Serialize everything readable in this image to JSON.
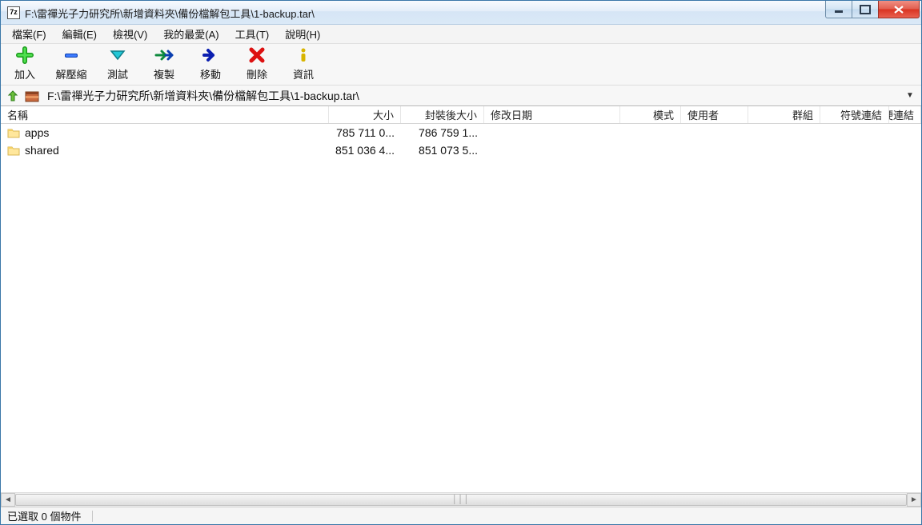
{
  "window": {
    "title": "F:\\雷禪光子力研究所\\新增資料夾\\備份檔解包工具\\1-backup.tar\\"
  },
  "menu": {
    "file": "檔案(F)",
    "edit": "編輯(E)",
    "view": "檢視(V)",
    "fav": "我的最愛(A)",
    "tools": "工具(T)",
    "help": "說明(H)"
  },
  "toolbar": {
    "add": "加入",
    "extract": "解壓縮",
    "test": "測試",
    "copy": "複製",
    "move": "移動",
    "delete": "刪除",
    "info": "資訊"
  },
  "address": {
    "path": "F:\\雷禪光子力研究所\\新增資料夾\\備份檔解包工具\\1-backup.tar\\"
  },
  "columns": {
    "name": "名稱",
    "size": "大小",
    "packed": "封裝後大小",
    "mtime": "修改日期",
    "mode": "模式",
    "user": "使用者",
    "group": "群組",
    "sym": "符號連結",
    "hard": "硬連結"
  },
  "rows": [
    {
      "name": "apps",
      "size": "785 711 0...",
      "packed": "786 759 1...",
      "mtime": "",
      "mode": "",
      "user": "",
      "group": "",
      "sym": "",
      "hard": ""
    },
    {
      "name": "shared",
      "size": "851 036 4...",
      "packed": "851 073 5...",
      "mtime": "",
      "mode": "",
      "user": "",
      "group": "",
      "sym": "",
      "hard": ""
    }
  ],
  "status": {
    "selected": "已選取 0 個物件"
  }
}
